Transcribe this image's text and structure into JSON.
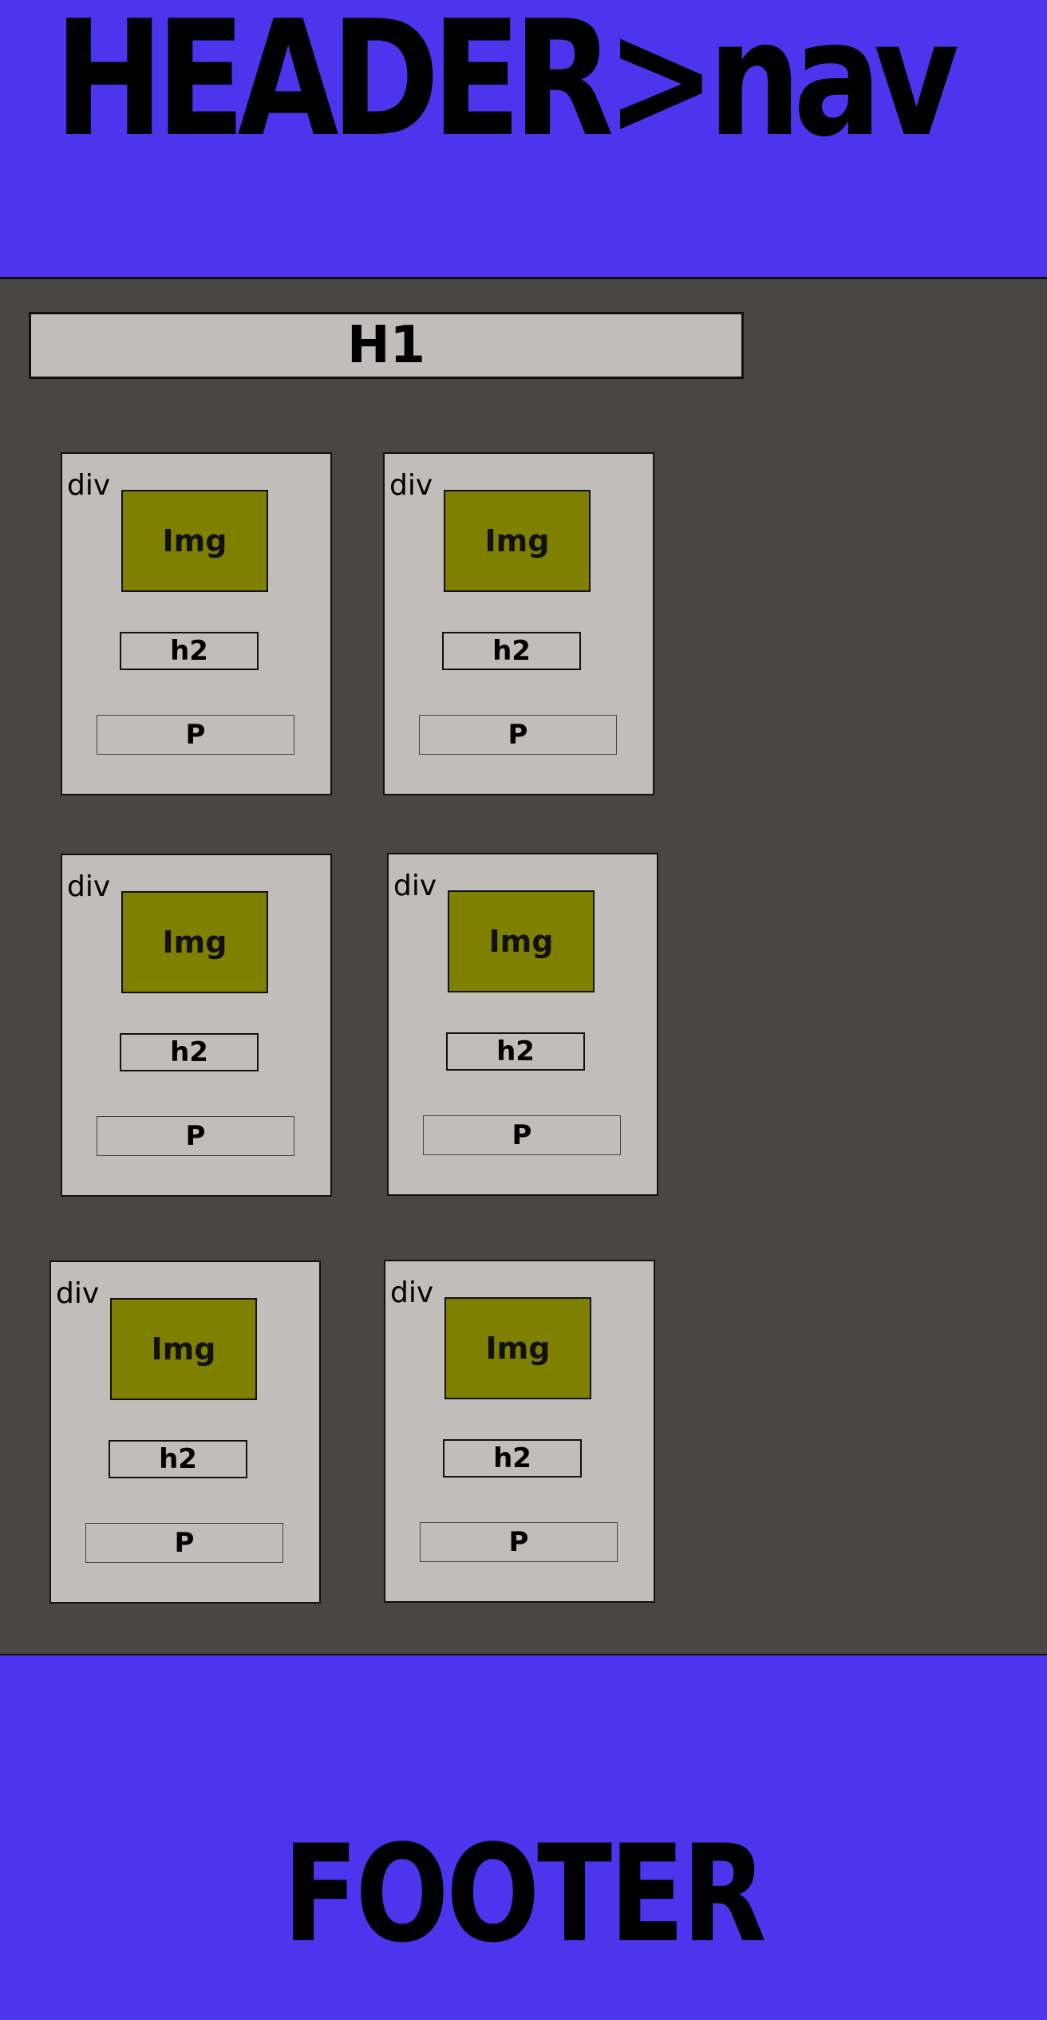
{
  "colors": {
    "accent": "#4d35ee",
    "main_bg": "#4a4644",
    "box_bg": "#c0bdba",
    "img_bg": "#7f7f00"
  },
  "header": {
    "title": "HEADER>nav"
  },
  "main": {
    "heading": "H1",
    "cards": [
      {
        "label": "div",
        "img": "Img",
        "h2": "h2",
        "p": "P"
      },
      {
        "label": "div",
        "img": "Img",
        "h2": "h2",
        "p": "P"
      },
      {
        "label": "div",
        "img": "Img",
        "h2": "h2",
        "p": "P"
      },
      {
        "label": "div",
        "img": "Img",
        "h2": "h2",
        "p": "P"
      },
      {
        "label": "div",
        "img": "Img",
        "h2": "h2",
        "p": "P"
      },
      {
        "label": "div",
        "img": "Img",
        "h2": "h2",
        "p": "P"
      }
    ]
  },
  "footer": {
    "title": "FOOTER"
  }
}
